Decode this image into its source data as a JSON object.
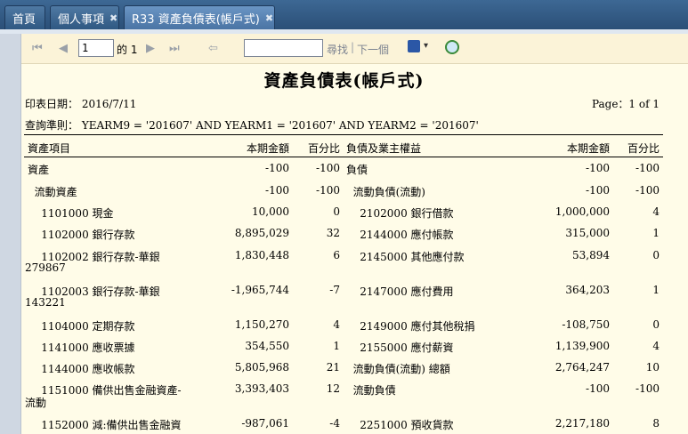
{
  "tabs": [
    {
      "label": "首頁",
      "closable": false
    },
    {
      "label": "個人事項",
      "closable": true
    },
    {
      "label": "R33 資產負債表(帳戶式)",
      "closable": true
    }
  ],
  "toolbar": {
    "page_value": "1",
    "of_text": "的 1",
    "search_value": "",
    "find_label": "尋找",
    "separator": "|",
    "next_label": "下一個",
    "icons": [
      "first-page-icon",
      "prev-page-icon",
      "next-page-icon",
      "last-page-icon",
      "back-icon",
      "export-icon",
      "refresh-icon"
    ]
  },
  "report": {
    "title": "資產負債表(帳戶式)",
    "print_date": "印表日期：  2016/7/11",
    "page_info": "Page：1 of 1",
    "criteria": "查詢準則：  YEARM9 = '201607' AND YEARM1 = '201607' AND YEARM2 = '201607'",
    "headers": {
      "asset_item": "資產項目",
      "current_amount": "本期金額",
      "percent": "百分比",
      "liability_item": "負債及業主權益",
      "current_amount2": "本期金額",
      "percent2": "百分比"
    },
    "rows": [
      {
        "a_name": "資產",
        "a_amt": "-100",
        "a_pct": "-100",
        "l_name": "負債",
        "l_amt": "-100",
        "l_pct": "-100"
      },
      {
        "a_name": "  流動資產",
        "a_amt": "-100",
        "a_pct": "-100",
        "l_name": "  流動負債(流動)",
        "l_amt": "-100",
        "l_pct": "-100"
      },
      {
        "a_name": "    1101000 現金",
        "a_amt": "10,000",
        "a_pct": "0",
        "l_name": "    2102000 銀行借款",
        "l_amt": "1,000,000",
        "l_pct": "4"
      },
      {
        "a_name": "    1102000 銀行存款",
        "a_amt": "8,895,029",
        "a_pct": "32",
        "l_name": "    2144000 應付帳款",
        "l_amt": "315,000",
        "l_pct": "1"
      },
      {
        "a_name": "    1102002 銀行存款-華銀",
        "a_name2": "279867",
        "a_amt": "1,830,448",
        "a_pct": "6",
        "l_name": "    2145000 其他應付款",
        "l_amt": "53,894",
        "l_pct": "0"
      },
      {
        "a_name": "    1102003 銀行存款-華銀",
        "a_name2": "143221",
        "a_amt": "-1,965,744",
        "a_pct": "-7",
        "l_name": "    2147000 應付費用",
        "l_amt": "364,203",
        "l_pct": "1"
      },
      {
        "a_name": "    1104000 定期存款",
        "a_amt": "1,150,270",
        "a_pct": "4",
        "l_name": "    2149000 應付其他稅捐",
        "l_amt": "-108,750",
        "l_pct": "0"
      },
      {
        "a_name": "    1141000 應收票據",
        "a_amt": "354,550",
        "a_pct": "1",
        "l_name": "    2155000 應付薪資",
        "l_amt": "1,139,900",
        "l_pct": "4"
      },
      {
        "a_name": "    1144000 應收帳款",
        "a_amt": "5,805,968",
        "a_pct": "21",
        "l_name": "  流動負債(流動) 總額",
        "l_amt": "2,764,247",
        "l_pct": "10"
      },
      {
        "a_name": "    1151000 備供出售金融資產-",
        "a_name2": "流動",
        "a_amt": "3,393,403",
        "a_pct": "12",
        "l_name": "  流動負債",
        "l_amt": "-100",
        "l_pct": "-100"
      },
      {
        "a_name": "    1152000 減:備供出售金融資",
        "a_amt": "-987,061",
        "a_pct": "-4",
        "l_name": "    2251000 預收貨款",
        "l_amt": "2,217,180",
        "l_pct": "8"
      }
    ]
  }
}
